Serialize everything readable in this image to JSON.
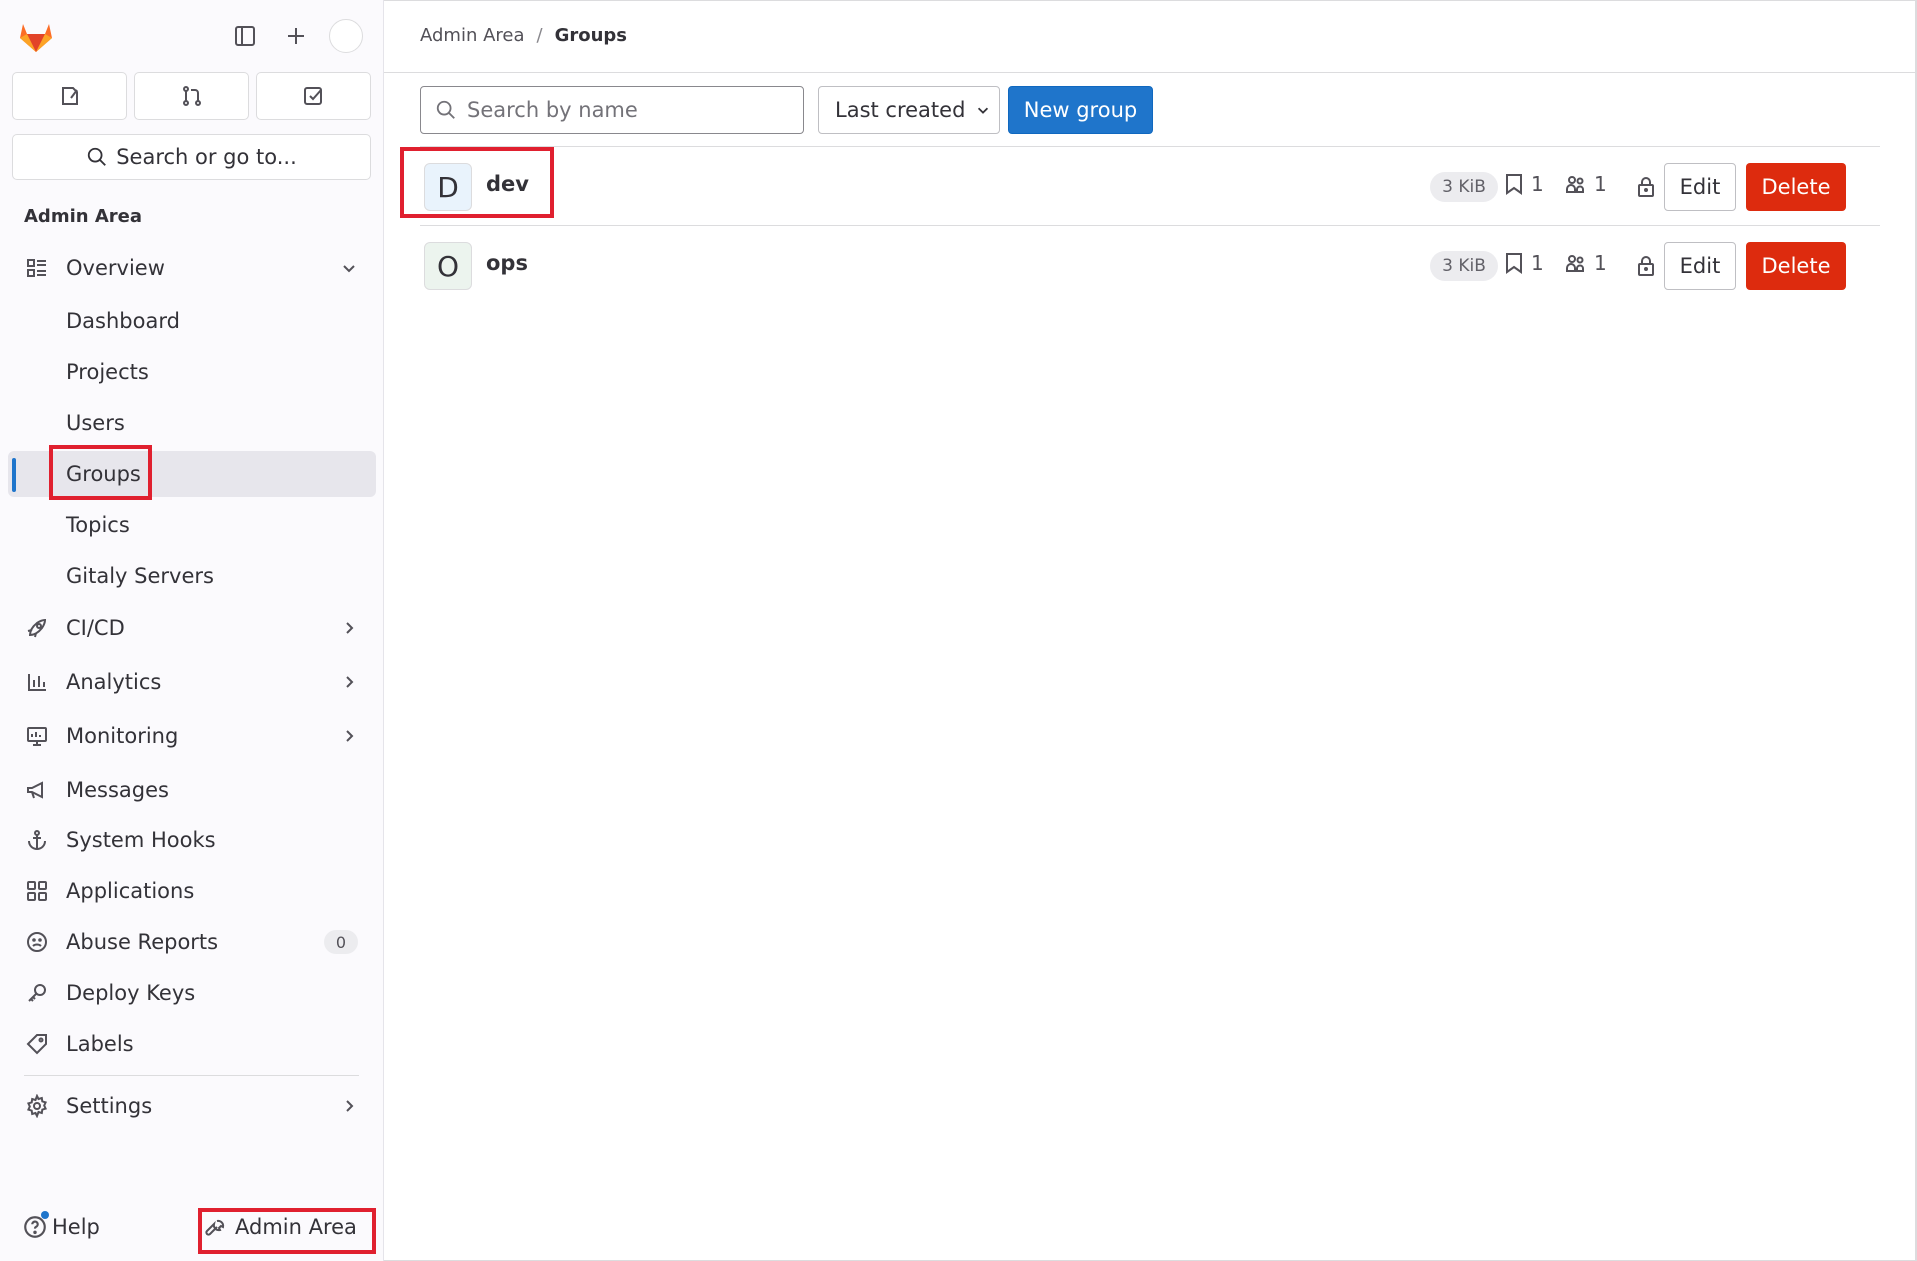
{
  "sidebar": {
    "search_label": "Search or go to...",
    "section_title": "Admin Area",
    "overview": {
      "label": "Overview",
      "items": [
        "Dashboard",
        "Projects",
        "Users",
        "Groups",
        "Topics",
        "Gitaly Servers"
      ]
    },
    "nav": [
      {
        "label": "CI/CD",
        "icon": "rocket-icon",
        "expandable": true
      },
      {
        "label": "Analytics",
        "icon": "chart-icon",
        "expandable": true
      },
      {
        "label": "Monitoring",
        "icon": "monitor-icon",
        "expandable": true
      },
      {
        "label": "Messages",
        "icon": "megaphone-icon",
        "expandable": false
      },
      {
        "label": "System Hooks",
        "icon": "anchor-icon",
        "expandable": false
      },
      {
        "label": "Applications",
        "icon": "applications-icon",
        "expandable": false
      },
      {
        "label": "Abuse Reports",
        "icon": "abuse-icon",
        "expandable": false,
        "badge": "0"
      },
      {
        "label": "Deploy Keys",
        "icon": "key-icon",
        "expandable": false
      },
      {
        "label": "Labels",
        "icon": "label-icon",
        "expandable": false
      }
    ],
    "settings_label": "Settings",
    "help_label": "Help",
    "admin_area_label": "Admin Area"
  },
  "breadcrumb": {
    "parent": "Admin Area",
    "separator": "/",
    "current": "Groups"
  },
  "toolbar": {
    "search_placeholder": "Search by name",
    "sort_label": "Last created",
    "new_group_label": "New group"
  },
  "groups": [
    {
      "initial": "D",
      "name": "dev",
      "size": "3 KiB",
      "projects": "1",
      "members": "1",
      "avatar_color": "#e9f3fc",
      "edit_label": "Edit",
      "delete_label": "Delete"
    },
    {
      "initial": "O",
      "name": "ops",
      "size": "3 KiB",
      "projects": "1",
      "members": "1",
      "avatar_color": "#ecf4ee",
      "edit_label": "Edit",
      "delete_label": "Delete"
    }
  ],
  "colors": {
    "primary": "#1f75cb",
    "danger": "#dd2b0e",
    "highlight": "#e0202f"
  }
}
